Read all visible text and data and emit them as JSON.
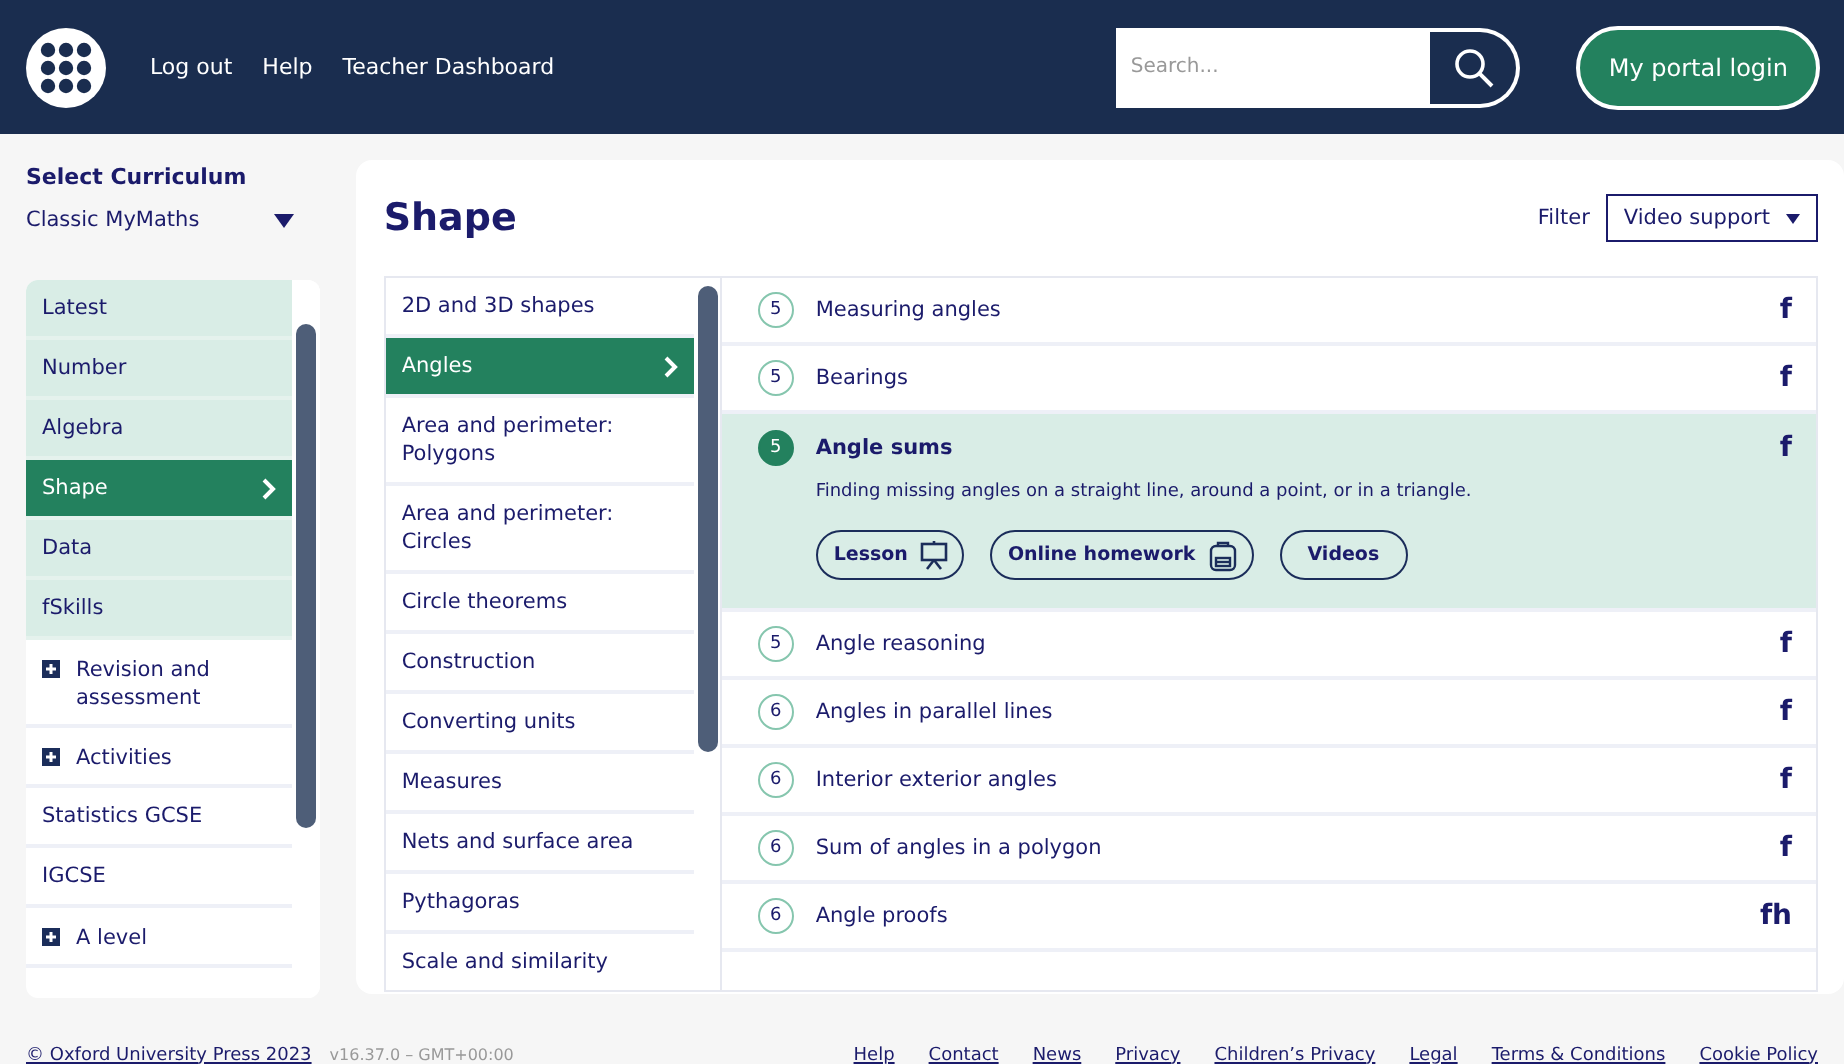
{
  "header": {
    "nav_links": [
      "Log out",
      "Help",
      "Teacher Dashboard"
    ],
    "search": {
      "placeholder": "Search..."
    },
    "login_button": "My portal login"
  },
  "sidebar": {
    "heading": "Select Curriculum",
    "curriculum_select": {
      "value": "Classic MyMaths"
    },
    "items": [
      {
        "label": "Latest",
        "kind": "strand",
        "selected": false
      },
      {
        "label": "Number",
        "kind": "strand",
        "selected": false
      },
      {
        "label": "Algebra",
        "kind": "strand",
        "selected": false
      },
      {
        "label": "Shape",
        "kind": "strand",
        "selected": true
      },
      {
        "label": "Data",
        "kind": "strand",
        "selected": false
      },
      {
        "label": "fSkills",
        "kind": "strand",
        "selected": false
      },
      {
        "label": "Revision and assessment",
        "kind": "group",
        "selected": false
      },
      {
        "label": "Activities",
        "kind": "group",
        "selected": false
      },
      {
        "label": "Statistics GCSE",
        "kind": "course",
        "selected": false
      },
      {
        "label": "IGCSE",
        "kind": "course",
        "selected": false
      },
      {
        "label": "A level",
        "kind": "group",
        "selected": false
      }
    ]
  },
  "main": {
    "title": "Shape",
    "filter": {
      "label": "Filter",
      "value": "Video support"
    },
    "topics": [
      {
        "label": "2D and 3D shapes",
        "selected": false
      },
      {
        "label": "Angles",
        "selected": true
      },
      {
        "label": "Area and perimeter: Polygons",
        "selected": false
      },
      {
        "label": "Area and perimeter: Circles",
        "selected": false
      },
      {
        "label": "Circle theorems",
        "selected": false
      },
      {
        "label": "Construction",
        "selected": false
      },
      {
        "label": "Converting units",
        "selected": false
      },
      {
        "label": "Measures",
        "selected": false
      },
      {
        "label": "Nets and surface area",
        "selected": false
      },
      {
        "label": "Pythagoras",
        "selected": false
      },
      {
        "label": "Scale and similarity",
        "selected": false
      }
    ],
    "lessons": [
      {
        "level": "5",
        "title": "Measuring angles",
        "tag": "f",
        "selected": false
      },
      {
        "level": "5",
        "title": "Bearings",
        "tag": "f",
        "selected": false
      },
      {
        "level": "5",
        "title": "Angle sums",
        "tag": "f",
        "selected": true,
        "description": "Finding missing angles on a straight line, around a point, or in a triangle.",
        "buttons": [
          {
            "label": "Lesson",
            "kind": "lesson"
          },
          {
            "label": "Online homework",
            "kind": "homework"
          },
          {
            "label": "Videos",
            "kind": "videos"
          }
        ]
      },
      {
        "level": "5",
        "title": "Angle reasoning",
        "tag": "f",
        "selected": false
      },
      {
        "level": "6",
        "title": "Angles in parallel lines",
        "tag": "f",
        "selected": false
      },
      {
        "level": "6",
        "title": "Interior exterior angles",
        "tag": "f",
        "selected": false
      },
      {
        "level": "6",
        "title": "Sum of angles in a polygon",
        "tag": "f",
        "selected": false
      },
      {
        "level": "6",
        "title": "Angle proofs",
        "tag": "fh",
        "selected": false
      }
    ]
  },
  "footer": {
    "copyright": "© Oxford University Press 2023",
    "version": "v16.37.0 – GMT+00:00",
    "links": [
      "Help",
      "Contact",
      "News",
      "Privacy",
      "Children’s Privacy",
      "Legal",
      "Terms & Conditions",
      "Cookie Policy"
    ]
  }
}
